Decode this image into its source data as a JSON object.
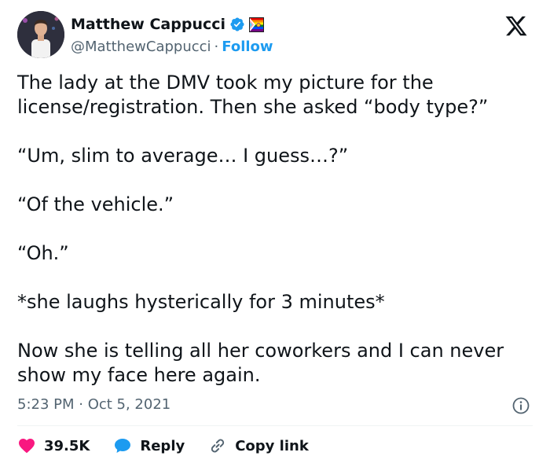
{
  "author": {
    "name": "Matthew Cappucci",
    "handle": "@MatthewCappucci",
    "separator": "·",
    "follow_label": "Follow"
  },
  "tweet": {
    "paragraphs": [
      "The lady at the DMV took my picture for the license/registration. Then she asked “body type?”",
      "“Um, slim to average… I guess…?”",
      "“Of the vehicle.”",
      "“Oh.”",
      "*she laughs hysterically for 3 minutes*",
      "Now she is telling all her coworkers and I can never show my face here again."
    ],
    "timestamp": "5:23 PM · Oct 5, 2021"
  },
  "actions": {
    "likes": "39.5K",
    "reply_label": "Reply",
    "copy_link_label": "Copy link"
  },
  "colors": {
    "accent": "#1d9bf0",
    "like": "#f91880",
    "text": "#0f1419",
    "muted": "#536471"
  },
  "icons": [
    "verified-badge-icon",
    "pride-flag-icon",
    "x-logo-icon",
    "info-icon",
    "heart-icon",
    "reply-bubble-icon",
    "link-icon"
  ]
}
